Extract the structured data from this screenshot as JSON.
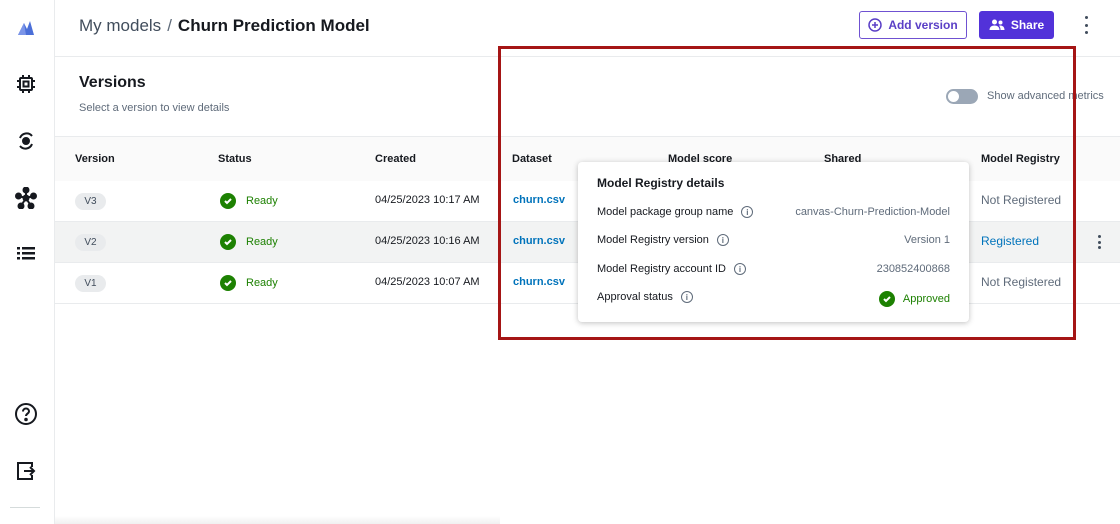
{
  "breadcrumb": {
    "parent": "My models",
    "separator": "/",
    "current": "Churn Prediction Model"
  },
  "header": {
    "add_version_label": "Add version",
    "share_label": "Share"
  },
  "versions": {
    "title": "Versions",
    "subtitle": "Select a version to view details",
    "advanced_toggle_label": "Show advanced metrics"
  },
  "table": {
    "columns": [
      "Version",
      "Status",
      "Created",
      "Dataset",
      "Model score",
      "Shared",
      "Model Registry"
    ],
    "rows": [
      {
        "version": "V3",
        "status": "Ready",
        "created": "04/25/2023 10:17 AM",
        "dataset": "churn.csv",
        "registry": "Not Registered"
      },
      {
        "version": "V2",
        "status": "Ready",
        "created": "04/25/2023 10:16 AM",
        "dataset": "churn.csv",
        "registry": "Registered"
      },
      {
        "version": "V1",
        "status": "Ready",
        "created": "04/25/2023 10:07 AM",
        "dataset": "churn.csv",
        "registry": "Not Registered"
      }
    ]
  },
  "popover": {
    "title": "Model Registry details",
    "fields": [
      {
        "label": "Model package group name",
        "value": "canvas-Churn-Prediction-Model"
      },
      {
        "label": "Model Registry version",
        "value": "Version 1"
      },
      {
        "label": "Model Registry account ID",
        "value": "230852400868"
      },
      {
        "label": "Approval status",
        "value": "Approved"
      }
    ]
  },
  "icons": {
    "sidebar": [
      "canvas-logo-icon",
      "chip-icon",
      "cycle-icon",
      "network-icon",
      "list-icon",
      "help-icon",
      "logout-icon"
    ],
    "info_glyph": "i"
  },
  "colors": {
    "accent": "#5232d9",
    "link": "#0073bb",
    "success": "#1d8102",
    "highlight": "#a51515"
  }
}
